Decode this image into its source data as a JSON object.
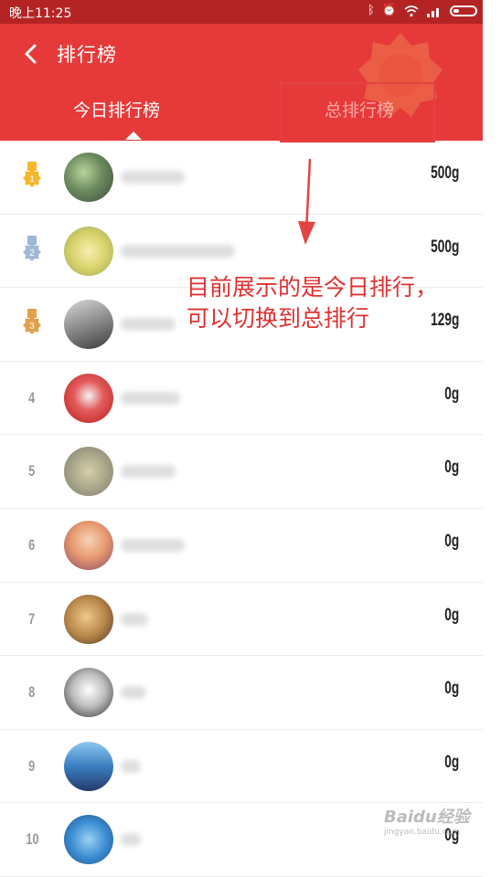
{
  "status_bar": {
    "time": "晚上11:25"
  },
  "header": {
    "title": "排行榜"
  },
  "tabs": [
    {
      "label": "今日排行榜",
      "active": true
    },
    {
      "label": "总排行榜",
      "active": false
    }
  ],
  "annotation": {
    "line1": "目前展示的是今日排行，",
    "line2": "可以切换到总排行"
  },
  "colors": {
    "header": "#e63a3a",
    "status_bar": "#b52424",
    "annotation": "#e03232",
    "gold": "#f5b62a",
    "silver": "#9fb8d6",
    "bronze": "#e0a04e"
  },
  "rows": [
    {
      "rank": "1",
      "medal": "gold-medal-icon",
      "weight": "500g"
    },
    {
      "rank": "2",
      "medal": "silver-medal-icon",
      "weight": "500g"
    },
    {
      "rank": "3",
      "medal": "bronze-medal-icon",
      "weight": "129g"
    },
    {
      "rank": "4",
      "weight": "0g"
    },
    {
      "rank": "5",
      "weight": "0g"
    },
    {
      "rank": "6",
      "weight": "0g"
    },
    {
      "rank": "7",
      "weight": "0g"
    },
    {
      "rank": "8",
      "weight": "0g"
    },
    {
      "rank": "9",
      "weight": "0g"
    },
    {
      "rank": "10",
      "weight": "0g"
    }
  ],
  "watermark": {
    "main": "Baidu经验",
    "sub": "jingyan.baidu.com"
  }
}
